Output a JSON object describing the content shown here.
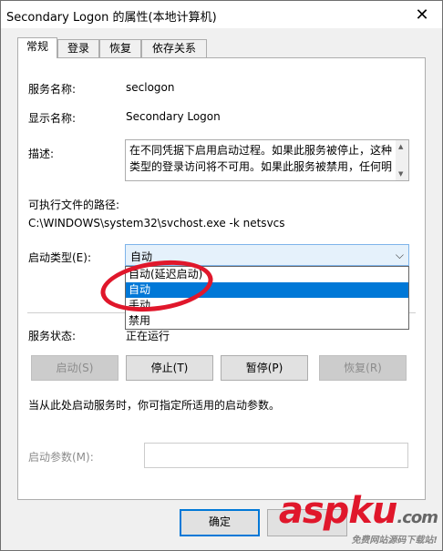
{
  "window": {
    "title": "Secondary Logon 的属性(本地计算机)"
  },
  "tabs": [
    {
      "label": "常规",
      "active": true
    },
    {
      "label": "登录",
      "active": false
    },
    {
      "label": "恢复",
      "active": false
    },
    {
      "label": "依存关系",
      "active": false
    }
  ],
  "general": {
    "service_name_label": "服务名称:",
    "service_name_value": "seclogon",
    "display_name_label": "显示名称:",
    "display_name_value": "Secondary Logon",
    "description_label": "描述:",
    "description_text": "在不同凭据下启用启动过程。如果此服务被停止，这种类型的登录访问将不可用。如果此服务被禁用，任何明",
    "path_label": "可执行文件的路径:",
    "path_value": "C:\\WINDOWS\\system32\\svchost.exe -k netsvcs",
    "startup_type_label": "启动类型(E):",
    "startup_type_value": "自动",
    "startup_options": [
      "自动(延迟启动)",
      "自动",
      "手动",
      "禁用"
    ],
    "startup_selected_index": 1,
    "service_status_label": "服务状态:",
    "service_status_value": "正在运行",
    "hint_text": "当从此处启动服务时，你可指定所适用的启动参数。",
    "start_params_label": "启动参数(M):"
  },
  "buttons": {
    "start": "启动(S)",
    "stop": "停止(T)",
    "pause": "暂停(P)",
    "resume": "恢复(R)",
    "ok": "确定"
  },
  "watermark": {
    "brand": "aspku",
    "tld": ".com",
    "tagline": "免费网站源码下载站!"
  },
  "colors": {
    "accent": "#0078d7",
    "annotation": "#e0172b"
  }
}
